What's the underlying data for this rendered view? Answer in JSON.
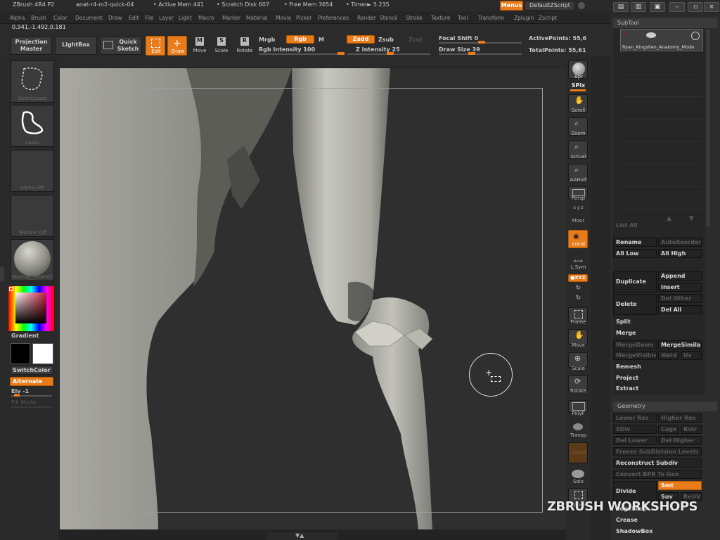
{
  "title": {
    "app": "ZBrush 4R4 P2",
    "doc": "anat-r4-m2-quick-04",
    "active_mem": "• Active Mem 441",
    "scratch_disk": "• Scratch Disk 607",
    "free_mem": "• Free Mem 3654",
    "timer": "• Timer► 5.235",
    "menus_btn": "Menus",
    "default_script": "DefaultZScript"
  },
  "menu": [
    "Alpha",
    "Brush",
    "Color",
    "Document",
    "Draw",
    "Edit",
    "File",
    "Layer",
    "Light",
    "Macro",
    "Marker",
    "Material",
    "Movie",
    "Picker",
    "Preferences",
    "Render",
    "Stencil",
    "Stroke",
    "Texture",
    "Tool",
    "Transform",
    "Zplugin",
    "Zscript"
  ],
  "coords": "0.941,-1.492,0.181",
  "toolbar": {
    "projection_master": "Projection Master",
    "lightbox": "LightBox",
    "quick_sketch": "Quick Sketch",
    "edit": "Edit",
    "draw": "Draw",
    "move": "Move",
    "scale": "Scale",
    "rotate": "Rotate",
    "mrgb": "Mrgb",
    "rgb": "Rgb",
    "m": "M",
    "rgb_intensity": "Rgb Intensity 100",
    "zadd": "Zadd",
    "zsub": "Zsub",
    "zcut": "Zcut",
    "z_intensity": "Z Intensity 25",
    "focal_shift": "Focal Shift 0",
    "draw_size": "Draw Size 39",
    "active_points": "ActivePoints: 55,6",
    "total_points": "TotalPoints: 55,61"
  },
  "left": {
    "select_lasso": "SelectLasso",
    "lasso": "Lasso",
    "alpha_off": "Alpha_Off",
    "texture_off": "Texture_Off",
    "material": "MatCap_GreenCl",
    "gradient": "Gradient",
    "switch_color": "SwitchColor",
    "alternate": "Alternate",
    "elv": "Elv -1",
    "fill_mode": "Fill Mode"
  },
  "right_shelf": {
    "bpr": "Bpr",
    "spix": "SPix",
    "scroll": "Scroll",
    "zoom": "Zoom",
    "actual": "Actual",
    "aahalf": "AAHalf",
    "persp": "Persp",
    "floor": "Floor",
    "local": "Local",
    "lsym": "L.Sym",
    "xyz": "●XYZ",
    "frame": "Frame",
    "move": "Move",
    "scale": "Scale",
    "rotate": "Rotate",
    "polyf": "PolyF",
    "transp": "Transp",
    "ghost": "Ghost",
    "solo": "Solo",
    "xpose": "Xpose"
  },
  "subtool": {
    "header": "SubTool",
    "item_name": "Ryan_Kingslien_Anatomy_Mode",
    "list_all": "List All",
    "rename": "Rename",
    "auto_reorder": "AutoReorder",
    "all_low": "All Low",
    "all_high": "All High",
    "duplicate": "Duplicate",
    "append": "Append",
    "insert": "Insert",
    "delete": "Delete",
    "del_other": "Del Other",
    "del_all": "Del All",
    "split": "Split",
    "merge": "Merge",
    "merge_down": "MergeDown",
    "merge_similar": "MergeSimilar",
    "merge_visible": "MergeVisible",
    "weld": "Weld",
    "uv": "Uv",
    "remesh": "Remesh",
    "project": "Project",
    "extract": "Extract"
  },
  "geometry": {
    "header": "Geometry",
    "lower_res": "Lower Res",
    "higher_res": "Higher Res",
    "sdiv": "SDiv",
    "cage": "Cage",
    "rstr": "Rstr",
    "del_lower": "Del Lower",
    "del_higher": "Del Higher",
    "freeze": "Freeze SubDivision Levels",
    "reconstruct": "Reconstruct Subdiv",
    "convert_bpr": "Convert BPR To Geo",
    "divide": "Divide",
    "smt": "Smt",
    "suv": "Suv",
    "reuv": "ReUV",
    "edgeloop": "EdgeLoop",
    "crease": "Crease",
    "shadowbox": "ShadowBox"
  },
  "watermark": "ZBRUSH WORKSHOPS"
}
